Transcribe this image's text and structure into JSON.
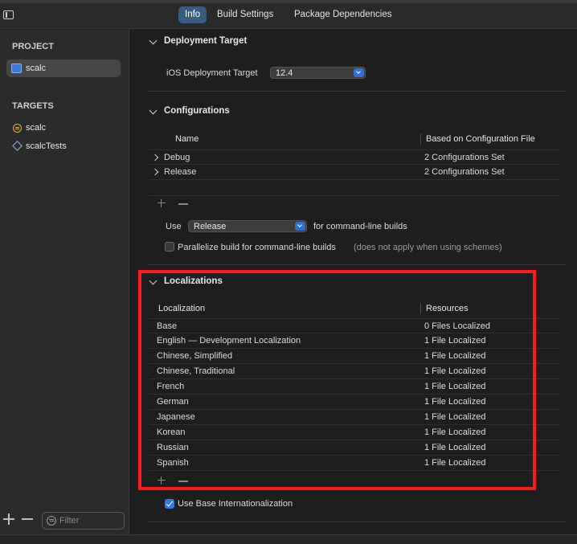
{
  "tabs": [
    {
      "label": "Info",
      "active": true
    },
    {
      "label": "Build Settings",
      "active": false
    },
    {
      "label": "Package Dependencies",
      "active": false
    }
  ],
  "sidebar": {
    "project_header": "PROJECT",
    "project_item": "scalc",
    "targets_header": "TARGETS",
    "targets": [
      "scalc",
      "scalcTests"
    ],
    "filter_placeholder": "Filter"
  },
  "deployment": {
    "title": "Deployment Target",
    "label": "iOS Deployment Target",
    "value": "12.4"
  },
  "configurations": {
    "title": "Configurations",
    "col_name": "Name",
    "col_based_on": "Based on Configuration File",
    "rows": [
      {
        "name": "Debug",
        "value": "2 Configurations Set"
      },
      {
        "name": "Release",
        "value": "2 Configurations Set"
      }
    ],
    "use_label": "Use",
    "use_value": "Release",
    "use_suffix": "for command-line builds",
    "parallelize_label": "Parallelize build for command-line builds",
    "parallelize_note": "(does not apply when using schemes)",
    "parallelize_checked": false
  },
  "localizations": {
    "title": "Localizations",
    "col_localization": "Localization",
    "col_resources": "Resources",
    "rows": [
      {
        "name": "Base",
        "value": "0 Files Localized"
      },
      {
        "name": "English — Development Localization",
        "value": "1 File Localized"
      },
      {
        "name": "Chinese, Simplified",
        "value": "1 File Localized"
      },
      {
        "name": "Chinese, Traditional",
        "value": "1 File Localized"
      },
      {
        "name": "French",
        "value": "1 File Localized"
      },
      {
        "name": "German",
        "value": "1 File Localized"
      },
      {
        "name": "Japanese",
        "value": "1 File Localized"
      },
      {
        "name": "Korean",
        "value": "1 File Localized"
      },
      {
        "name": "Russian",
        "value": "1 File Localized"
      },
      {
        "name": "Spanish",
        "value": "1 File Localized"
      }
    ],
    "use_base_label": "Use Base Internationalization",
    "use_base_checked": true
  },
  "colors": {
    "highlight": "#ff1a1a",
    "accent": "#2f7ae5"
  }
}
